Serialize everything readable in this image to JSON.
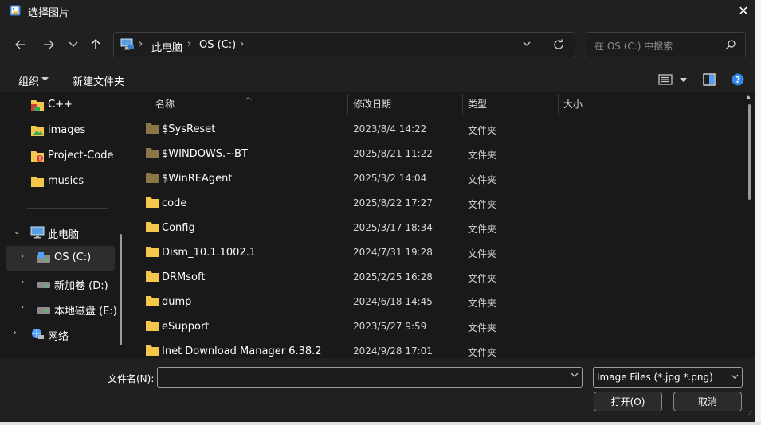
{
  "window": {
    "title": "选择图片",
    "close_glyph": "✕"
  },
  "nav": {
    "back_icon": "arrow-left-icon",
    "forward_icon": "arrow-right-icon",
    "recent_icon": "chevron-down-icon",
    "up_icon": "arrow-up-icon",
    "breadcrumb": [
      "此电脑",
      "OS (C:)"
    ],
    "search_placeholder": "在 OS (C:) 中搜索"
  },
  "commandbar": {
    "organize": "组织",
    "new_folder": "新建文件夹"
  },
  "navpane": {
    "items": [
      {
        "label": "C++",
        "icon": "folder-cpp-icon"
      },
      {
        "label": "images",
        "icon": "folder-images-icon"
      },
      {
        "label": "Project-Code",
        "icon": "folder-project-icon"
      },
      {
        "label": "musics",
        "icon": "folder-icon"
      }
    ],
    "this_pc": "此电脑",
    "drives": [
      {
        "label": "OS (C:)",
        "icon": "windows-drive-icon",
        "selected": true
      },
      {
        "label": "新加卷 (D:)",
        "icon": "drive-icon"
      },
      {
        "label": "本地磁盘 (E:)",
        "icon": "drive-icon"
      }
    ],
    "network": "网络"
  },
  "filelist": {
    "columns": [
      "名称",
      "修改日期",
      "类型",
      "大小"
    ],
    "rows": [
      {
        "name": "$SysReset",
        "date": "2023/8/4 14:22",
        "type": "文件夹",
        "hidden": true
      },
      {
        "name": "$WINDOWS.~BT",
        "date": "2025/8/21 11:22",
        "type": "文件夹",
        "hidden": true
      },
      {
        "name": "$WinREAgent",
        "date": "2025/3/2 14:04",
        "type": "文件夹",
        "hidden": true
      },
      {
        "name": "code",
        "date": "2025/8/22 17:27",
        "type": "文件夹",
        "hidden": false
      },
      {
        "name": "Config",
        "date": "2025/3/17 18:34",
        "type": "文件夹",
        "hidden": false
      },
      {
        "name": "Dism_10.1.1002.1",
        "date": "2024/7/31 19:28",
        "type": "文件夹",
        "hidden": false
      },
      {
        "name": "DRMsoft",
        "date": "2025/2/25 16:28",
        "type": "文件夹",
        "hidden": false
      },
      {
        "name": "dump",
        "date": "2024/6/18 14:45",
        "type": "文件夹",
        "hidden": false
      },
      {
        "name": "eSupport",
        "date": "2023/5/27 9:59",
        "type": "文件夹",
        "hidden": false
      },
      {
        "name": "Inet Download Manager 6.38.2",
        "date": "2024/9/28 17:01",
        "type": "文件夹",
        "hidden": false
      }
    ]
  },
  "bottom": {
    "filename_label": "文件名(N):",
    "filename_value": "",
    "filter": "Image Files (*.jpg *.png)",
    "open": "打开(O)",
    "cancel": "取消"
  },
  "colors": {
    "accent": "#4ea1ff",
    "folder": "#f4c64a",
    "folder_hidden": "#8a7646",
    "background": "#202020"
  }
}
